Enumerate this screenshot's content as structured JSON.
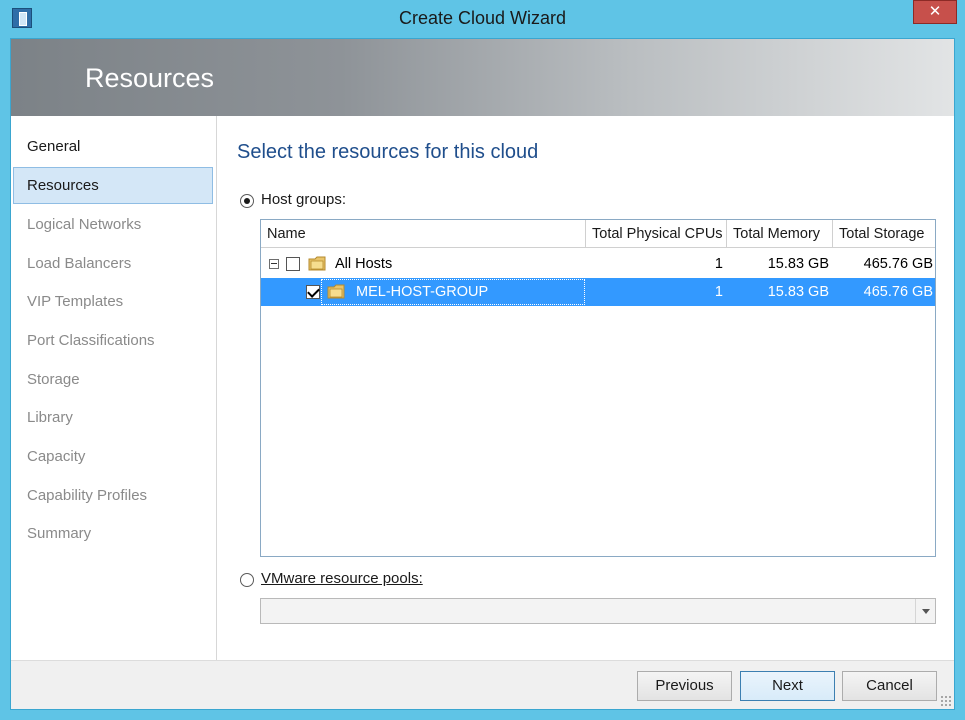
{
  "window": {
    "title": "Create Cloud Wizard",
    "close_glyph": "✕"
  },
  "banner": {
    "title": "Resources"
  },
  "sidebar": {
    "items": [
      {
        "label": "General",
        "state": "done"
      },
      {
        "label": "Resources",
        "state": "active"
      },
      {
        "label": "Logical Networks",
        "state": "pending"
      },
      {
        "label": "Load Balancers",
        "state": "pending"
      },
      {
        "label": "VIP Templates",
        "state": "pending"
      },
      {
        "label": "Port Classifications",
        "state": "pending"
      },
      {
        "label": "Storage",
        "state": "pending"
      },
      {
        "label": "Library",
        "state": "pending"
      },
      {
        "label": "Capacity",
        "state": "pending"
      },
      {
        "label": "Capability Profiles",
        "state": "pending"
      },
      {
        "label": "Summary",
        "state": "pending"
      }
    ]
  },
  "main": {
    "heading": "Select the resources for this cloud",
    "host_groups": {
      "label": "Host groups:",
      "selected": true
    },
    "vmware": {
      "label": "VMware resource pools:",
      "selected": false,
      "value": ""
    },
    "grid": {
      "columns": [
        "Name",
        "Total Physical CPUs",
        "Total Memory",
        "Total Storage"
      ],
      "rows": [
        {
          "name": "All Hosts",
          "cpus": "1",
          "memory": "15.83 GB",
          "storage": "465.76 GB",
          "checked": false,
          "expanded": true,
          "selected": false
        },
        {
          "name": "MEL-HOST-GROUP",
          "cpus": "1",
          "memory": "15.83 GB",
          "storage": "465.76 GB",
          "checked": true,
          "selected": true
        }
      ]
    }
  },
  "footer": {
    "previous": "Previous",
    "next": "Next",
    "cancel": "Cancel"
  },
  "colors": {
    "frame": "#5fc4e6",
    "selection": "#3399ff",
    "heading": "#1f4e8c",
    "close": "#c7504b"
  }
}
